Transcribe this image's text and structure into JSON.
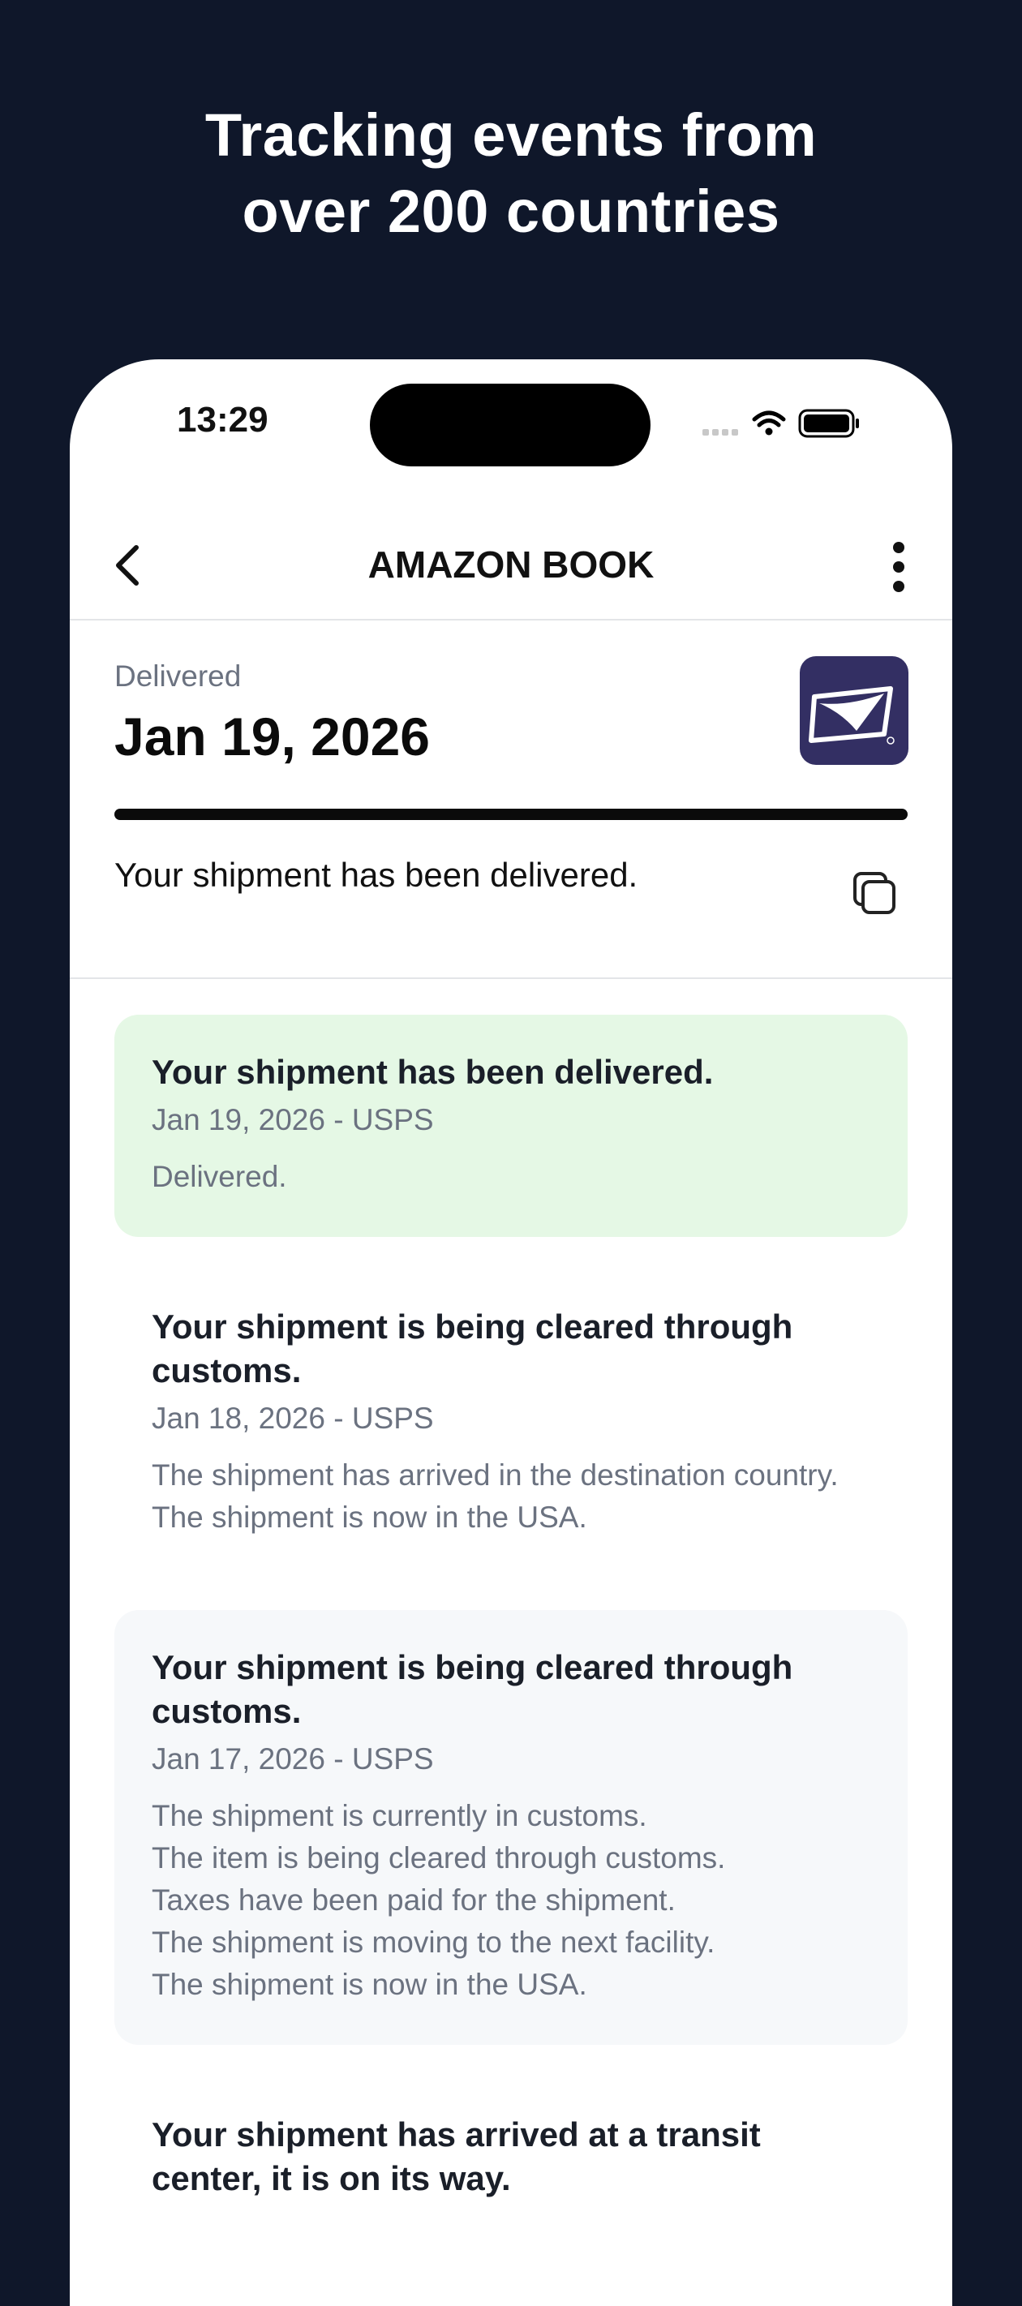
{
  "headline": {
    "line1": "Tracking events from",
    "line2": "over 200 countries"
  },
  "status_bar": {
    "time": "13:29"
  },
  "nav": {
    "title": "AMAZON BOOK"
  },
  "summary": {
    "label": "Delivered",
    "date": "Jan 19, 2026",
    "status": "Your shipment has been delivered.",
    "progress_fraction": 1.0,
    "carrier_logo_color": "#332f63"
  },
  "events": [
    {
      "title": "Your shipment has been delivered.",
      "meta": "Jan 19, 2026 - USPS",
      "desc": [
        "Delivered."
      ]
    },
    {
      "title": "Your shipment is being cleared through customs.",
      "meta": "Jan 18, 2026 - USPS",
      "desc": [
        "The shipment has arrived in the destination country.",
        "The shipment is now in the USA."
      ]
    },
    {
      "title": "Your shipment is being cleared through customs.",
      "meta": "Jan 17, 2026 - USPS",
      "desc": [
        "The shipment is currently in customs.",
        "The item is being cleared through customs.",
        "Taxes have been paid for the shipment.",
        "The shipment is moving to the next facility.",
        "The shipment is now in the USA."
      ]
    },
    {
      "title": "Your shipment has arrived at a transit center, it is on its way.",
      "meta": "",
      "desc": []
    }
  ],
  "colors": {
    "background": "#0f172a",
    "delivered_card": "#e5f8e5",
    "alt_card": "#f6f8fa"
  }
}
